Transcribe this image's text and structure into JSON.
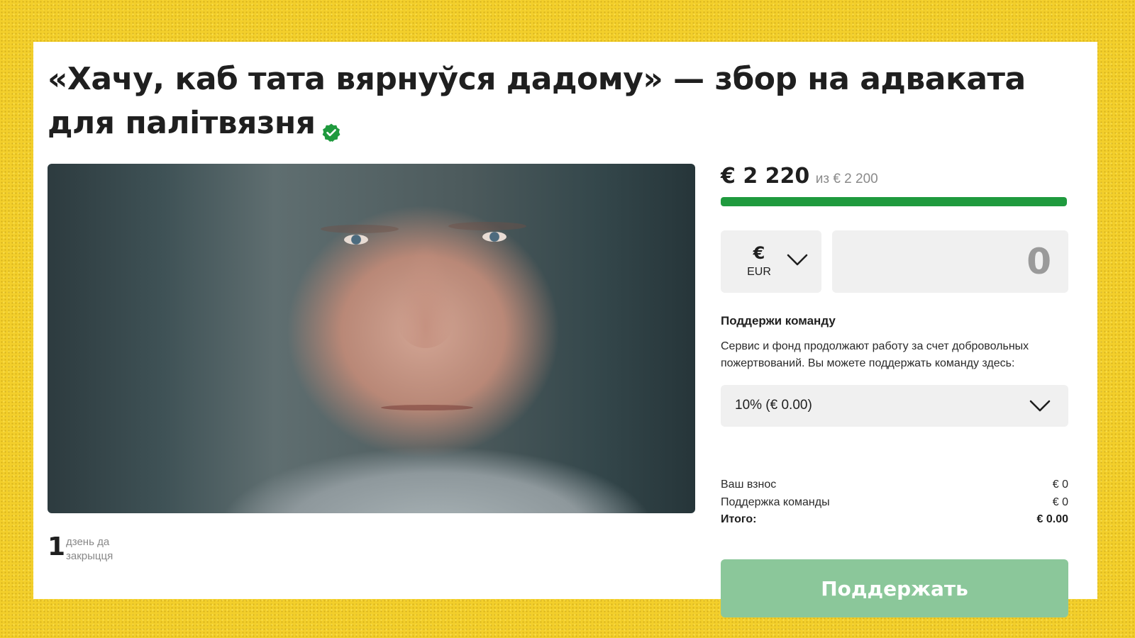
{
  "campaign": {
    "title": "«Хачу, каб тата вярнуўся дадому» — збор на адваката для палітвязня",
    "verified": true,
    "days_left": "1",
    "days_left_label": "дзень да закрыцця"
  },
  "funding": {
    "raised": "€ 2 220",
    "goal": "из € 2 200",
    "progress_fraction": 1.0,
    "progress_color": "#1f9a3e"
  },
  "donation": {
    "currency_symbol": "€",
    "currency_code": "EUR",
    "amount_value": "",
    "amount_placeholder": "0"
  },
  "support_team": {
    "title": "Поддержи команду",
    "description": "Сервис и фонд продолжают работу за счет добровольных пожертвований. Вы можете поддержать команду здесь:",
    "selected_option": "10% (€ 0.00)"
  },
  "summary": {
    "contribution_label": "Ваш взнос",
    "contribution_value": "€ 0",
    "team_label": "Поддержка команды",
    "team_value": "€ 0",
    "total_label": "Итого:",
    "total_value": "€ 0.00"
  },
  "actions": {
    "donate_label": "Поддержать",
    "donate_color": "#8bc79a"
  },
  "icons": {
    "verified": "verified-badge-icon",
    "dropdown": "chevron-down-icon"
  }
}
